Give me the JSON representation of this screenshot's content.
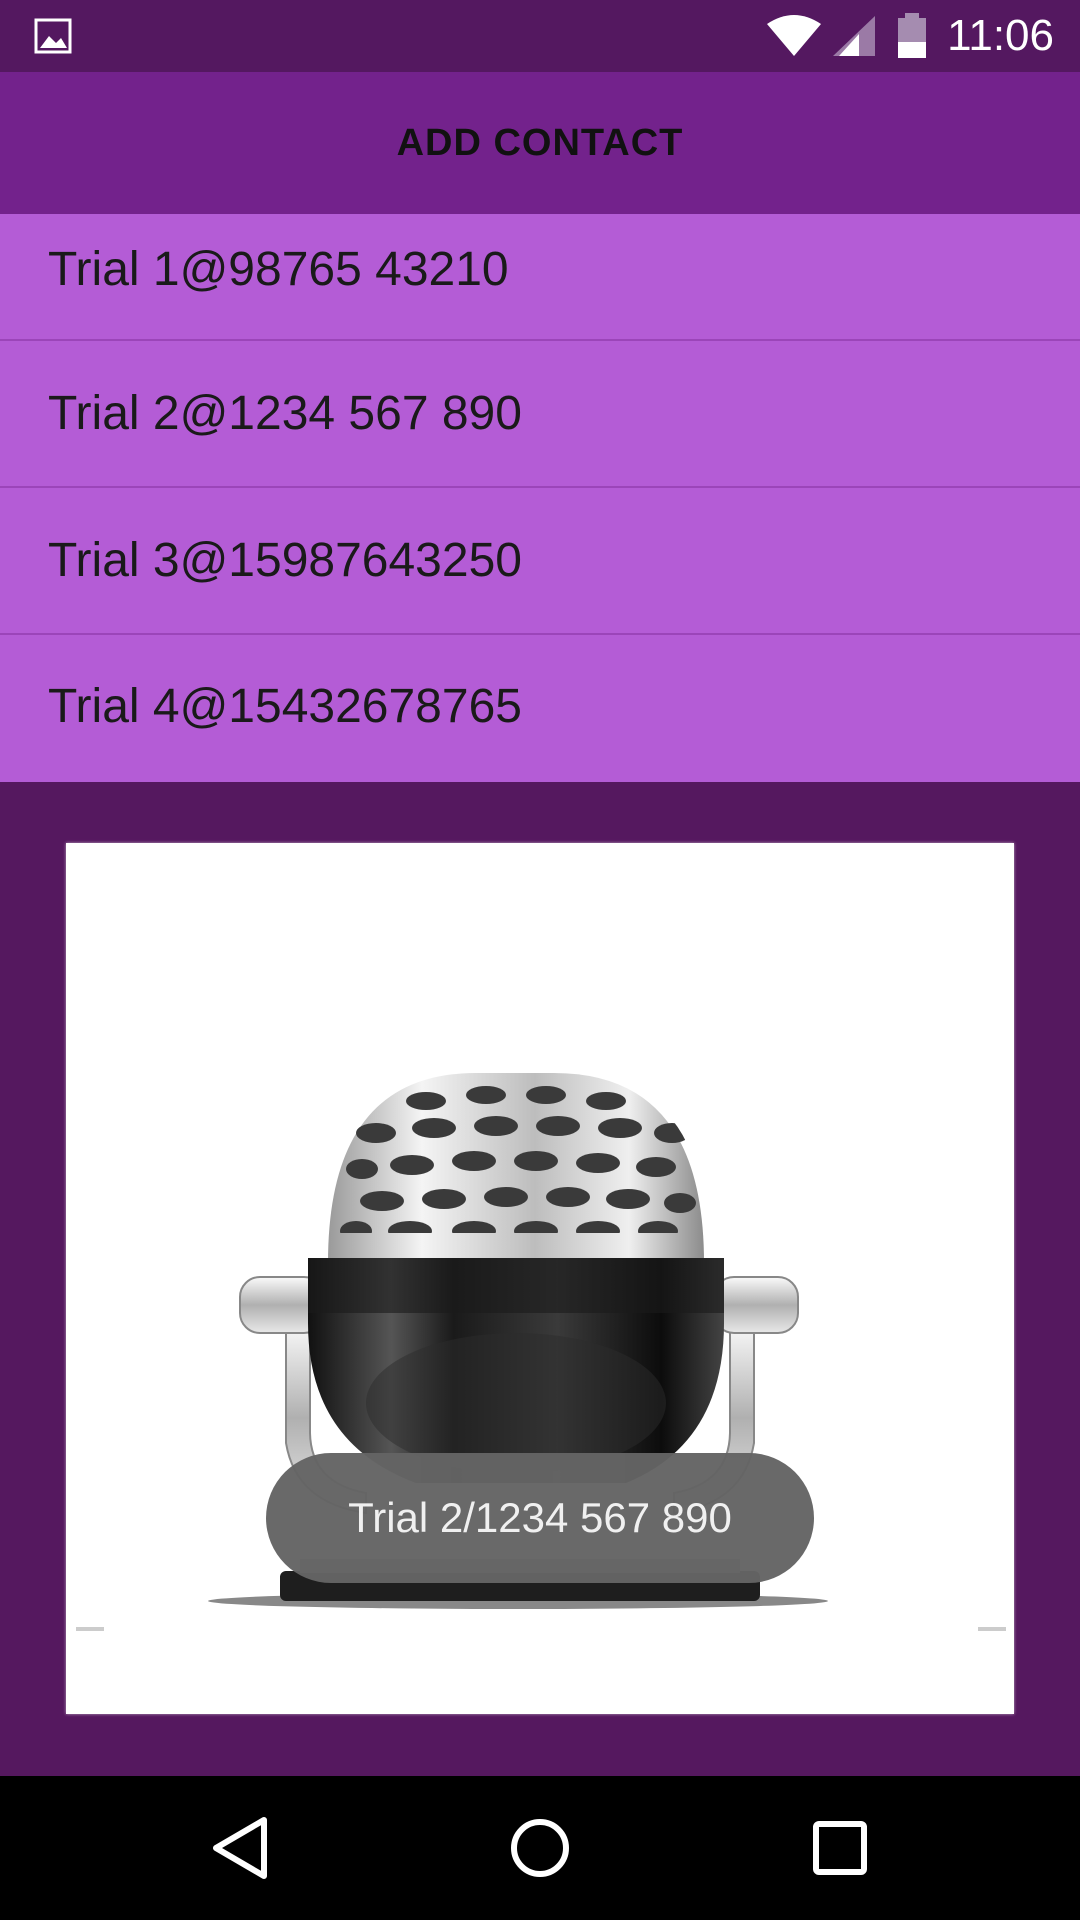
{
  "status_bar": {
    "time": "11:06",
    "icons": [
      "image-icon",
      "wifi-icon",
      "signal-icon",
      "battery-icon"
    ]
  },
  "app_bar": {
    "title": "ADD CONTACT"
  },
  "contacts": [
    {
      "label": "Trial 1@98765 43210"
    },
    {
      "label": "Trial 2@1234 567 890"
    },
    {
      "label": "Trial 3@15987643250"
    },
    {
      "label": "Trial 4@15432678765"
    }
  ],
  "toast": {
    "text": "Trial 2/1234 567 890"
  },
  "nav_bar": {
    "icons": [
      "back-icon",
      "home-icon",
      "recents-icon"
    ]
  },
  "colors": {
    "status_bar": "#541860",
    "app_bar": "#73228c",
    "list_bg": "#b45cd6",
    "page_bg": "#55185f"
  }
}
